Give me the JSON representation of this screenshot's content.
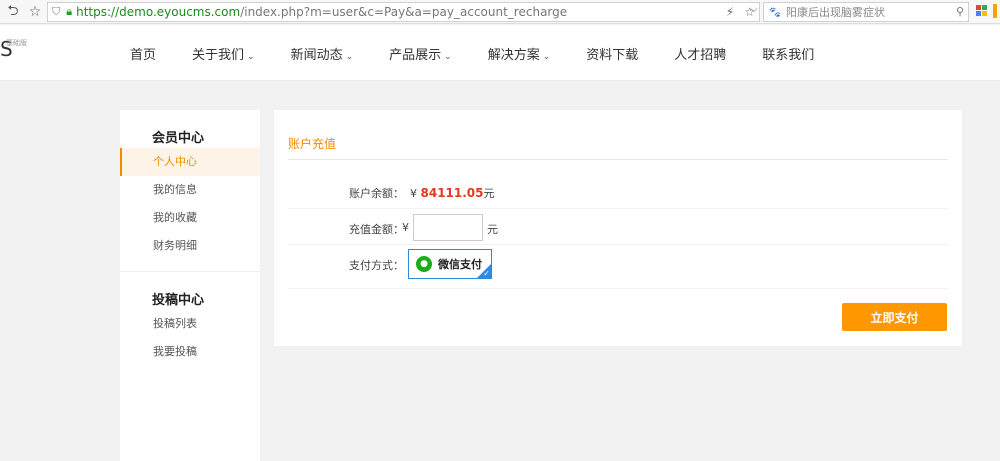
{
  "browser": {
    "url_scheme": "https://",
    "url_host": "demo.eyoucms.com",
    "url_rest": "/index.php?m=user&c=Pay&a=pay_account_recharge",
    "search_text": "阳康后出现脑雾症状"
  },
  "site": {
    "logo_badge": "基础版",
    "nav": [
      {
        "label": "首页",
        "dropdown": false
      },
      {
        "label": "关于我们",
        "dropdown": true
      },
      {
        "label": "新闻动态",
        "dropdown": true
      },
      {
        "label": "产品展示",
        "dropdown": true
      },
      {
        "label": "解决方案",
        "dropdown": true
      },
      {
        "label": "资料下载",
        "dropdown": false
      },
      {
        "label": "人才招聘",
        "dropdown": false
      },
      {
        "label": "联系我们",
        "dropdown": false
      }
    ]
  },
  "sidebar": {
    "member_title": "会员中心",
    "member_items": [
      "个人中心",
      "我的信息",
      "我的收藏",
      "财务明细"
    ],
    "active_index": 0,
    "submit_title": "投稿中心",
    "submit_items": [
      "投稿列表",
      "我要投稿"
    ]
  },
  "recharge": {
    "title": "账户充值",
    "balance_label": "账户余额：",
    "currency": "¥",
    "balance_value": "84111.05",
    "balance_unit": "元",
    "amount_label": "充值金额：",
    "amount_value": "",
    "amount_unit": "元",
    "method_label": "支付方式：",
    "method_option": "微信支付",
    "submit_label": "立即支付"
  },
  "colors": {
    "accent": "#f28b00",
    "button": "#ff9800",
    "balance": "#e23b1b",
    "wechat": "#1aad19",
    "selected_border": "#2b8ae6"
  }
}
